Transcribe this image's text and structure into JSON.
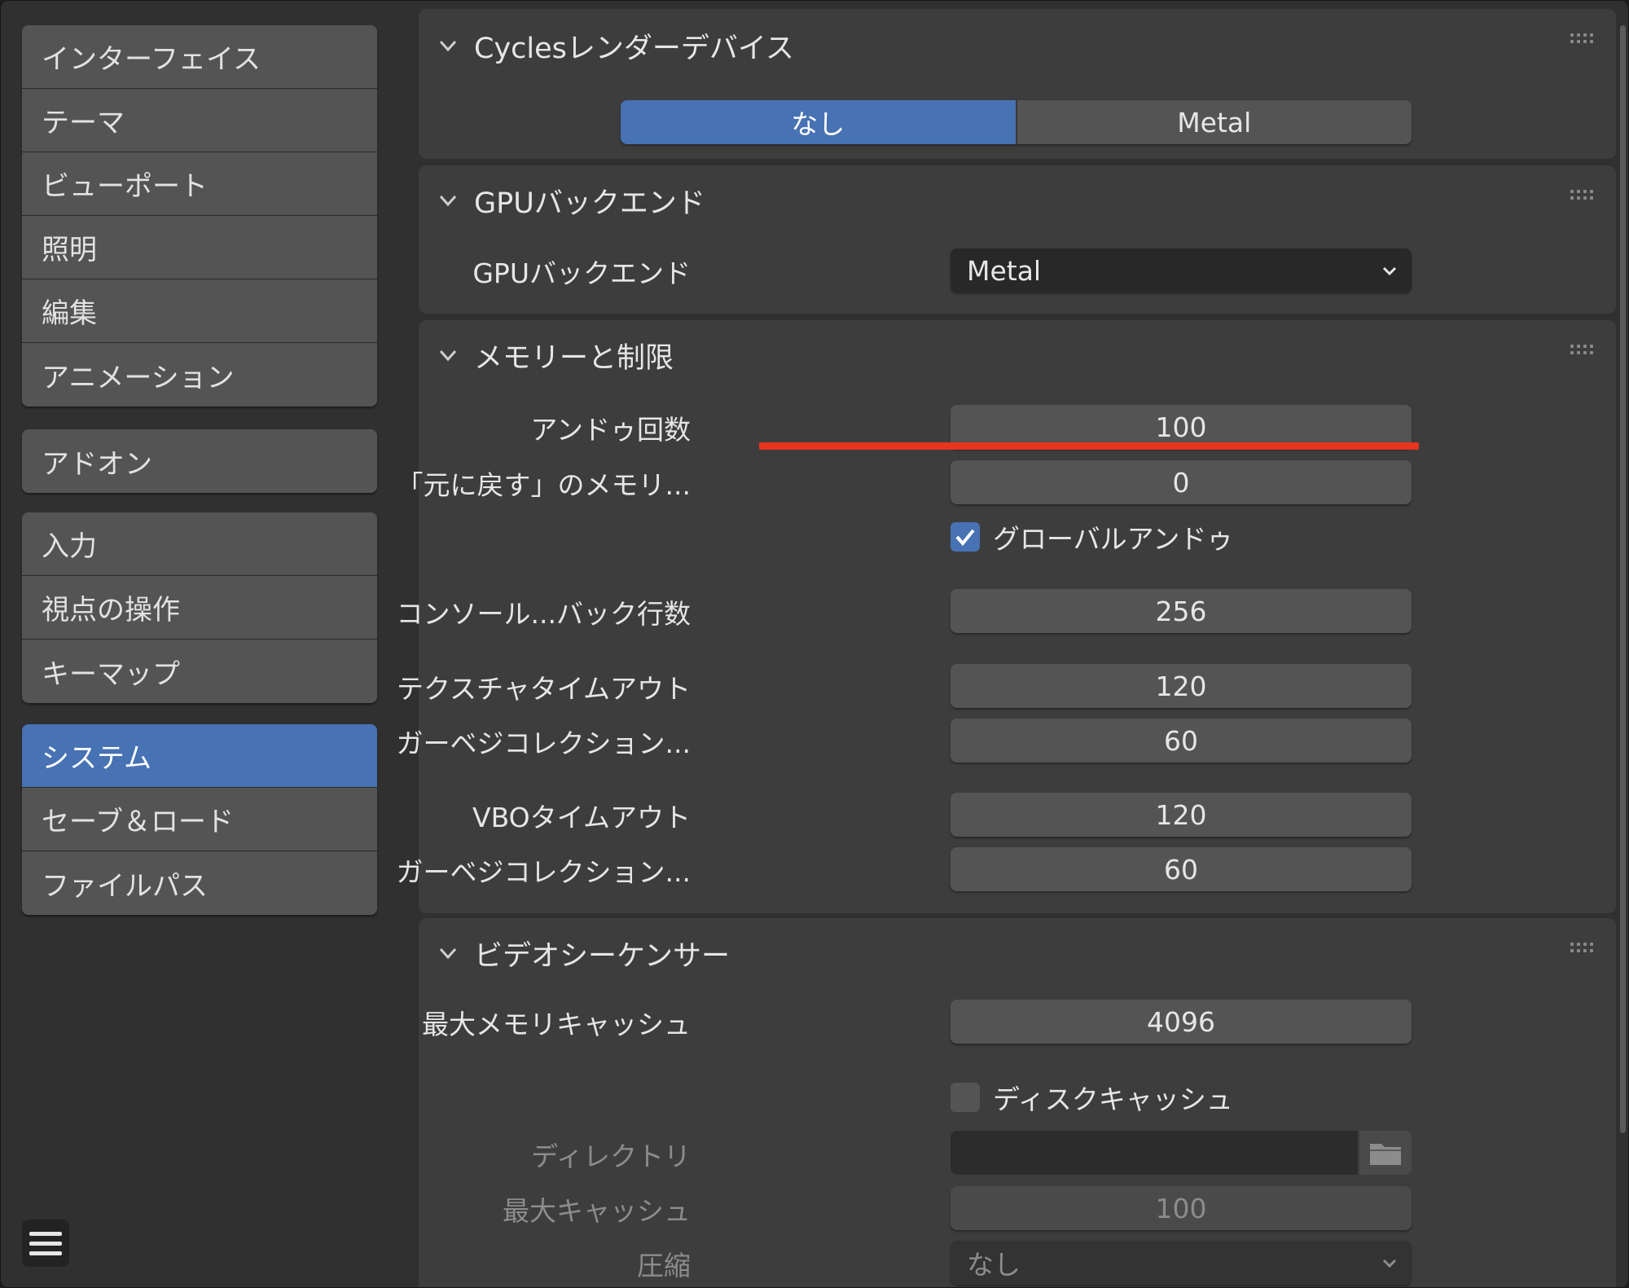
{
  "sidebar": {
    "group1": [
      "インターフェイス",
      "テーマ",
      "ビューポート",
      "照明",
      "編集",
      "アニメーション"
    ],
    "group2": [
      "アドオン"
    ],
    "group3": [
      "入力",
      "視点の操作",
      "キーマップ"
    ],
    "group4": [
      "システム",
      "セーブ＆ロード",
      "ファイルパス"
    ],
    "active": "システム"
  },
  "cycles": {
    "title": "Cyclesレンダーデバイス",
    "options": [
      "なし",
      "Metal"
    ],
    "selected": "なし"
  },
  "gpu": {
    "title": "GPUバックエンド",
    "label": "GPUバックエンド",
    "value": "Metal"
  },
  "memory": {
    "title": "メモリーと制限",
    "undo_steps_label": "アンドゥ回数",
    "undo_steps": "100",
    "undo_memory_label": "「元に戻す」のメモリ...",
    "undo_memory": "0",
    "global_undo_label": "グローバルアンドゥ",
    "global_undo_checked": true,
    "console_label": "コンソール...バック行数",
    "console": "256",
    "texture_timeout_label": "テクスチャタイムアウト",
    "texture_timeout": "120",
    "gc1_label": "ガーベジコレクション...",
    "gc1": "60",
    "vbo_timeout_label": "VBOタイムアウト",
    "vbo_timeout": "120",
    "gc2_label": "ガーベジコレクション...",
    "gc2": "60"
  },
  "vse": {
    "title": "ビデオシーケンサー",
    "max_cache_label": "最大メモリキャッシュ",
    "max_cache": "4096",
    "disk_cache_label": "ディスクキャッシュ",
    "disk_cache_checked": false,
    "directory_label": "ディレクトリ",
    "directory": "",
    "max_disk_label": "最大キャッシュ",
    "max_disk": "100",
    "compression_label": "圧縮",
    "compression": "なし"
  },
  "colors": {
    "accent": "#4772b3",
    "highlight_underline": "#e8341c"
  }
}
